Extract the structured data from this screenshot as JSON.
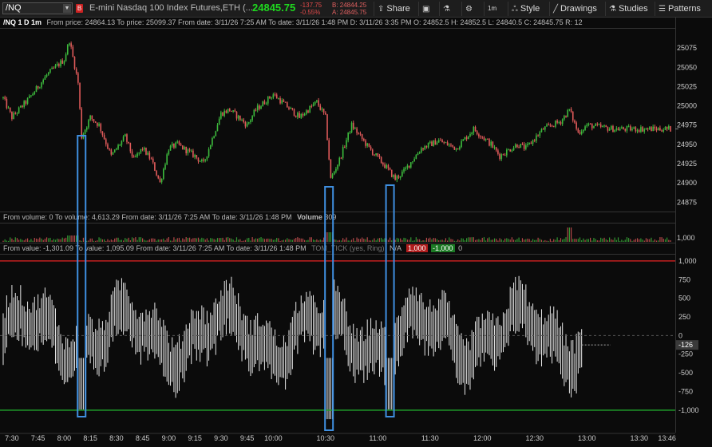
{
  "toolbar": {
    "symbol": "/NQ",
    "badge": "B",
    "description": "E-mini Nasdaq 100 Index Futures,ETH (...",
    "last": "24845.75",
    "net_change": "-137.75",
    "pct_change": "-0.55%",
    "bid": "B: 24844.25",
    "ask": "A: 24845.75",
    "buttons": [
      "Share",
      "1m",
      "Style",
      "Drawings",
      "Studies",
      "Patterns"
    ],
    "icons": [
      "share-icon",
      "screenshot-icon",
      "flask-icon",
      "gear-icon",
      "timeframe-icon",
      "style-icon",
      "drawings-icon",
      "studies-icon",
      "patterns-icon"
    ]
  },
  "price_info": {
    "title": "/NQ 1 D 1m",
    "text": "From price: 24864.13  To price: 25099.37  From date: 3/11/26 7:25 AM  To date: 3/11/26 1:48 PM  D: 3/11/26 3:35 PM  O: 24852.5  H: 24852.5  L: 24840.5  C: 24845.75  R: 12"
  },
  "volume_info": {
    "text": "From volume: 0  To volume: 4,613.29  From date: 3/11/26 7:25 AM  To date: 3/11/26 1:48 PM",
    "label": "Volume",
    "value": "309"
  },
  "tick_info": {
    "text": "From value: -1,301.09  To value: 1,095.09  From date: 3/11/26 7:25 AM  To date: 3/11/26 1:48 PM",
    "study": "TOM_TICK (yes, Ring)",
    "na": "N/A",
    "upper": "1,000",
    "lower": "-1,000",
    "zero": "0"
  },
  "colors": {
    "up": "#3dbb3d",
    "down": "#e05a5a",
    "highlight": "#3f8fe0",
    "upper_line": "#c21f1f",
    "lower_line": "#1f9f2a",
    "last_price_bg": "#3a3a3a"
  },
  "chart_data": [
    {
      "type": "candlestick",
      "title": "/NQ 1 D 1m",
      "ylim": [
        24865,
        25100
      ],
      "y_ticks": [
        "25075",
        "25050",
        "25025",
        "25000",
        "24975",
        "24950",
        "24925",
        "24900",
        "24875"
      ],
      "close_path": [
        {
          "x": "7:25",
          "y": 25010
        },
        {
          "x": "7:30",
          "y": 24985
        },
        {
          "x": "7:40",
          "y": 25010
        },
        {
          "x": "7:50",
          "y": 25040
        },
        {
          "x": "7:55",
          "y": 25050
        },
        {
          "x": "8:00",
          "y": 25060
        },
        {
          "x": "8:03",
          "y": 25085
        },
        {
          "x": "8:08",
          "y": 25030
        },
        {
          "x": "8:10",
          "y": 24960
        },
        {
          "x": "8:15",
          "y": 24985
        },
        {
          "x": "8:20",
          "y": 24975
        },
        {
          "x": "8:27",
          "y": 24935
        },
        {
          "x": "8:35",
          "y": 24960
        },
        {
          "x": "8:40",
          "y": 24930
        },
        {
          "x": "8:45",
          "y": 24945
        },
        {
          "x": "8:50",
          "y": 24930
        },
        {
          "x": "8:55",
          "y": 24900
        },
        {
          "x": "9:00",
          "y": 24945
        },
        {
          "x": "9:05",
          "y": 24950
        },
        {
          "x": "9:15",
          "y": 24935
        },
        {
          "x": "9:20",
          "y": 24925
        },
        {
          "x": "9:30",
          "y": 24990
        },
        {
          "x": "9:35",
          "y": 24995
        },
        {
          "x": "9:45",
          "y": 24975
        },
        {
          "x": "9:50",
          "y": 24995
        },
        {
          "x": "10:00",
          "y": 25015
        },
        {
          "x": "10:05",
          "y": 25005
        },
        {
          "x": "10:15",
          "y": 24985
        },
        {
          "x": "10:25",
          "y": 25005
        },
        {
          "x": "10:30",
          "y": 24985
        },
        {
          "x": "10:33",
          "y": 24905
        },
        {
          "x": "10:38",
          "y": 24930
        },
        {
          "x": "10:45",
          "y": 24975
        },
        {
          "x": "10:55",
          "y": 24945
        },
        {
          "x": "11:05",
          "y": 24920
        },
        {
          "x": "11:10",
          "y": 24905
        },
        {
          "x": "11:15",
          "y": 24915
        },
        {
          "x": "11:25",
          "y": 24945
        },
        {
          "x": "11:35",
          "y": 24955
        },
        {
          "x": "11:45",
          "y": 24945
        },
        {
          "x": "11:55",
          "y": 24970
        },
        {
          "x": "12:05",
          "y": 24950
        },
        {
          "x": "12:10",
          "y": 24935
        },
        {
          "x": "12:20",
          "y": 24950
        },
        {
          "x": "12:25",
          "y": 24945
        },
        {
          "x": "12:35",
          "y": 24970
        },
        {
          "x": "12:45",
          "y": 24980
        },
        {
          "x": "12:50",
          "y": 24995
        },
        {
          "x": "12:55",
          "y": 24965
        },
        {
          "x": "13:00",
          "y": 24975
        },
        {
          "x": "13:15",
          "y": 24970
        },
        {
          "x": "13:30",
          "y": 24970
        },
        {
          "x": "13:48",
          "y": 24970
        }
      ],
      "last_price": "24845.75"
    },
    {
      "type": "bar",
      "title": "Volume",
      "y_ticks": [
        "1,000"
      ],
      "last_value": "309"
    },
    {
      "type": "bar",
      "title": "TOM_TICK (yes, Ring)",
      "ylim": [
        -1301.09,
        1095.09
      ],
      "y_ticks": [
        "1,000",
        "750",
        "500",
        "250",
        "0",
        "-250",
        "-500",
        "-750",
        "-1,000"
      ],
      "reference_lines": [
        1000,
        0,
        -1000
      ],
      "last_value": "-126",
      "highlighted_lows_time": [
        "8:10",
        "10:32",
        "11:07"
      ],
      "highlighted_low_values": [
        -990,
        -1120,
        -990
      ]
    }
  ],
  "x_axis": {
    "ticks": [
      "7:30",
      "7:45",
      "8:00",
      "8:15",
      "8:30",
      "8:45",
      "9:00",
      "9:15",
      "9:30",
      "9:45",
      "10:00",
      "10:30",
      "11:00",
      "11:30",
      "12:00",
      "12:30",
      "13:00",
      "13:30",
      "13:46"
    ]
  }
}
